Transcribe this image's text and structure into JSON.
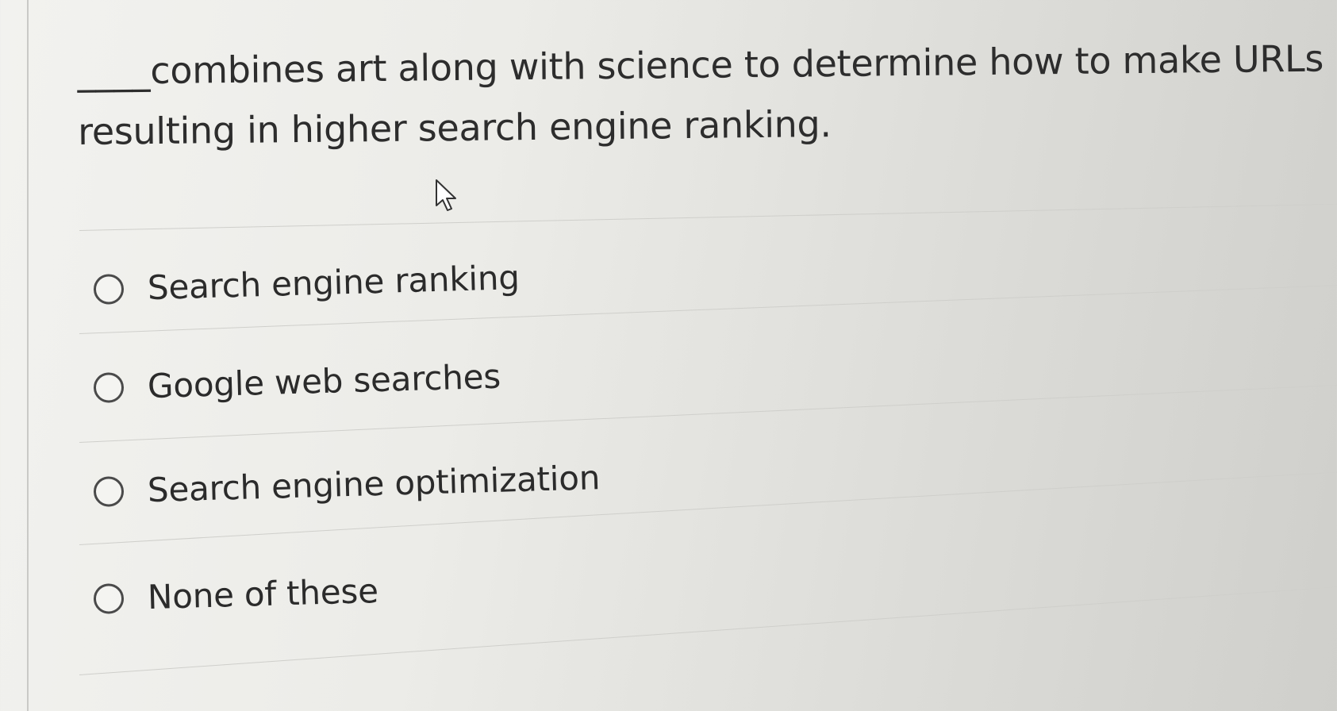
{
  "question": {
    "line1_blank": "____",
    "line1_text": "combines art along with science to determine how to make URLs more attracti",
    "line2_text": "resulting in higher search engine ranking."
  },
  "options": [
    {
      "label": "Search engine ranking",
      "selected": false
    },
    {
      "label": "Google web searches",
      "selected": false
    },
    {
      "label": "Search engine optimization",
      "selected": false
    },
    {
      "label": "None of these",
      "selected": false
    }
  ],
  "icons": {
    "cursor": "arrow-cursor-icon",
    "radio": "radio-button-icon"
  }
}
